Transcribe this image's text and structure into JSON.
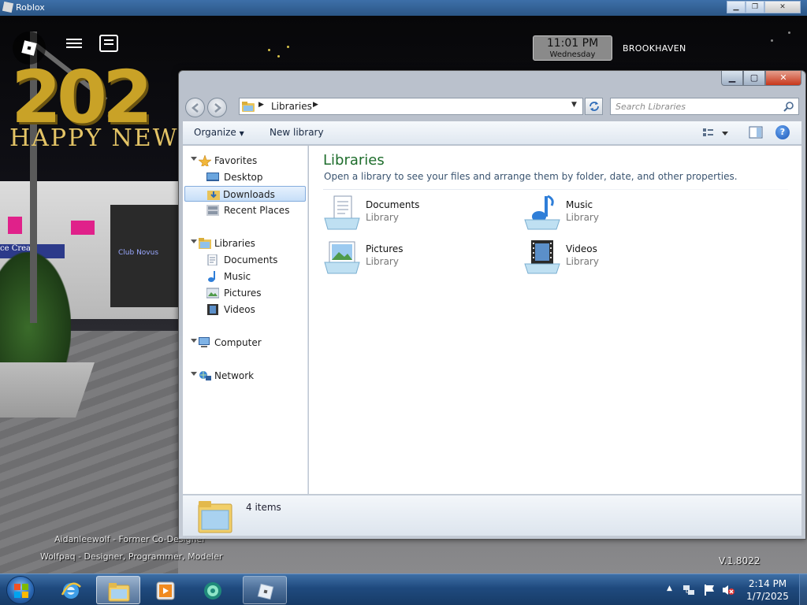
{
  "roblox": {
    "window_title": "Roblox",
    "hud": {
      "clock_time": "11:01 PM",
      "clock_day": "Wednesday",
      "place_name": "BROOKHAVEN"
    },
    "scene": {
      "banner_number": "202",
      "banner_text": "HAPPY NEW",
      "sign_left": "ce Crea",
      "sign_right": "Club Novus"
    },
    "credits": [
      "Aidanleewolf - Former Co-Designer",
      "Wolfpaq - Designer, Programmer, Modeler"
    ],
    "version": "V.1.8022"
  },
  "explorer": {
    "address": {
      "location": "Libraries"
    },
    "search": {
      "placeholder": "Search Libraries"
    },
    "toolbar": {
      "organize_label": "Organize",
      "new_library_label": "New library"
    },
    "nav": {
      "favorites": {
        "label": "Favorites",
        "items": [
          "Desktop",
          "Downloads",
          "Recent Places"
        ]
      },
      "libraries": {
        "label": "Libraries",
        "items": [
          "Documents",
          "Music",
          "Pictures",
          "Videos"
        ]
      },
      "computer_label": "Computer",
      "network_label": "Network",
      "selected": "Downloads"
    },
    "content": {
      "title": "Libraries",
      "subtitle": "Open a library to see your files and arrange them by folder, date, and other properties.",
      "libraries": [
        {
          "name": "Documents",
          "type": "Library",
          "icon": "documents-library-icon"
        },
        {
          "name": "Music",
          "type": "Library",
          "icon": "music-library-icon"
        },
        {
          "name": "Pictures",
          "type": "Library",
          "icon": "pictures-library-icon"
        },
        {
          "name": "Videos",
          "type": "Library",
          "icon": "videos-library-icon"
        }
      ]
    },
    "details": {
      "count": "4 items"
    }
  },
  "taskbar": {
    "time": "2:14 PM",
    "date": "1/7/2025"
  },
  "colors": {
    "library_title": "#1e6d2c",
    "taskbar": "#1f4a7e",
    "close_button": "#c7361a",
    "selection": "#c6def8"
  }
}
